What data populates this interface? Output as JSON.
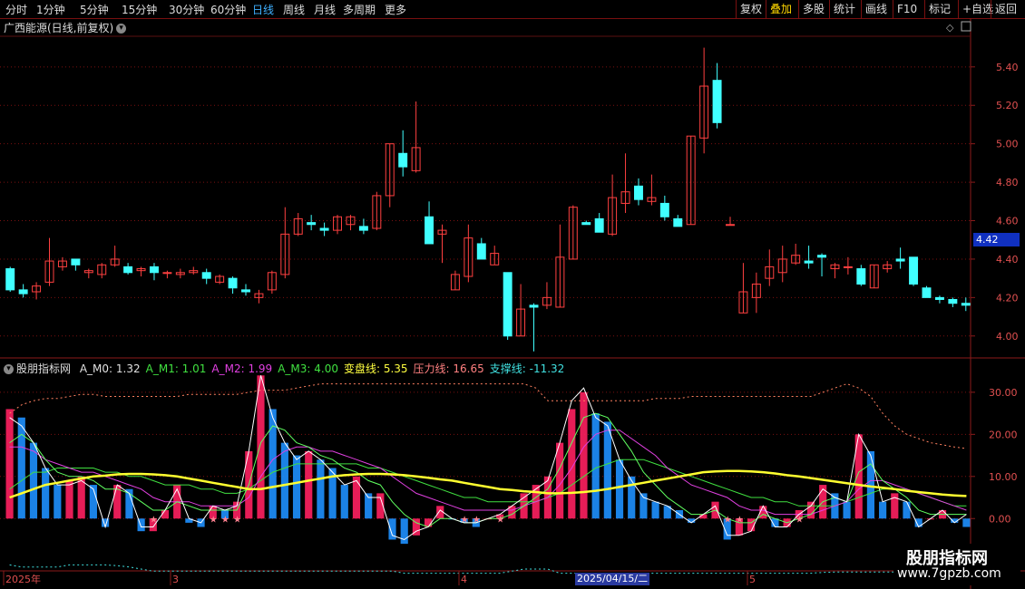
{
  "toolbar": {
    "periods": [
      "分时",
      "1分钟",
      "5分钟",
      "15分钟",
      "30分钟",
      "60分钟",
      "日线",
      "周线",
      "月线",
      "多周期",
      "更多"
    ],
    "active_period": "日线",
    "right_buttons": [
      "复权",
      "叠加",
      "多股",
      "统计",
      "画线",
      "F10",
      "标记",
      "+自选",
      "返回"
    ],
    "active_right": "叠加"
  },
  "stock": {
    "title": "广西能源(日线,前复权)",
    "current_price": "4.42"
  },
  "indicator": {
    "name": "股朋指标网",
    "values": [
      {
        "label": "A_M0: 1.32",
        "color": "#e0e0e0"
      },
      {
        "label": "A_M1: 1.01",
        "color": "#40e040"
      },
      {
        "label": "A_M2: 1.99",
        "color": "#e040e0"
      },
      {
        "label": "A_M3: 4.00",
        "color": "#40e040"
      },
      {
        "label": "变盘线: 5.35",
        "color": "#ffff40"
      },
      {
        "label": "压力线: 16.65",
        "color": "#ff8080"
      },
      {
        "label": "支撑线: -11.32",
        "color": "#40e0e0"
      }
    ]
  },
  "x_axis": {
    "labels": [
      "2025年",
      "3",
      "4",
      "2025/04/15/二",
      "5"
    ]
  },
  "watermark": {
    "line1": "股朋指标网",
    "line2": "www.7gpzb.com"
  },
  "chart_data": [
    {
      "type": "candlestick",
      "title": "广西能源(日线,前复权)",
      "ylim": [
        3.9,
        5.55
      ],
      "y_ticks": [
        "5.40",
        "5.20",
        "5.00",
        "4.80",
        "4.60",
        "4.40",
        "4.20",
        "4.00"
      ],
      "candles": [
        [
          4.35,
          4.24,
          4.36,
          4.23
        ],
        [
          4.24,
          4.22,
          4.27,
          4.2
        ],
        [
          4.23,
          4.26,
          4.28,
          4.19
        ],
        [
          4.28,
          4.39,
          4.51,
          4.26
        ],
        [
          4.36,
          4.39,
          4.41,
          4.34
        ],
        [
          4.4,
          4.37,
          4.4,
          4.34
        ],
        [
          4.33,
          4.34,
          4.35,
          4.3
        ],
        [
          4.32,
          4.37,
          4.38,
          4.3
        ],
        [
          4.37,
          4.4,
          4.47,
          4.36
        ],
        [
          4.36,
          4.33,
          4.38,
          4.32
        ],
        [
          4.34,
          4.35,
          4.36,
          4.31
        ],
        [
          4.36,
          4.33,
          4.38,
          4.29
        ],
        [
          4.33,
          4.33,
          4.34,
          4.3
        ],
        [
          4.32,
          4.33,
          4.35,
          4.3
        ],
        [
          4.33,
          4.34,
          4.36,
          4.32
        ],
        [
          4.33,
          4.3,
          4.35,
          4.27
        ],
        [
          4.28,
          4.31,
          4.32,
          4.27
        ],
        [
          4.3,
          4.25,
          4.31,
          4.22
        ],
        [
          4.24,
          4.23,
          4.27,
          4.21
        ],
        [
          4.2,
          4.22,
          4.24,
          4.17
        ],
        [
          4.24,
          4.33,
          4.34,
          4.22
        ],
        [
          4.32,
          4.53,
          4.67,
          4.3
        ],
        [
          4.53,
          4.61,
          4.64,
          4.52
        ],
        [
          4.59,
          4.58,
          4.63,
          4.55
        ],
        [
          4.56,
          4.55,
          4.59,
          4.52
        ],
        [
          4.55,
          4.62,
          4.63,
          4.53
        ],
        [
          4.58,
          4.62,
          4.63,
          4.55
        ],
        [
          4.57,
          4.55,
          4.61,
          4.53
        ],
        [
          4.56,
          4.73,
          4.75,
          4.55
        ],
        [
          4.73,
          5.0,
          5.0,
          4.67
        ],
        [
          4.95,
          4.88,
          5.07,
          4.83
        ],
        [
          4.86,
          4.98,
          5.22,
          4.85
        ],
        [
          4.62,
          4.48,
          4.7,
          4.48
        ],
        [
          4.53,
          4.55,
          4.58,
          4.38
        ],
        [
          4.24,
          4.32,
          4.34,
          4.24
        ],
        [
          4.31,
          4.51,
          4.58,
          4.28
        ],
        [
          4.48,
          4.4,
          4.51,
          4.4
        ],
        [
          4.37,
          4.43,
          4.47,
          4.37
        ],
        [
          4.33,
          4.0,
          4.33,
          3.98
        ],
        [
          4.0,
          4.14,
          4.27,
          4.0
        ],
        [
          4.16,
          4.15,
          4.17,
          3.92
        ],
        [
          4.16,
          4.2,
          4.28,
          4.14
        ],
        [
          4.15,
          4.41,
          4.58,
          4.15
        ],
        [
          4.4,
          4.67,
          4.68,
          4.4
        ],
        [
          4.59,
          4.58,
          4.6,
          4.58
        ],
        [
          4.61,
          4.54,
          4.64,
          4.54
        ],
        [
          4.53,
          4.72,
          4.84,
          4.52
        ],
        [
          4.69,
          4.75,
          4.95,
          4.64
        ],
        [
          4.78,
          4.71,
          4.82,
          4.68
        ],
        [
          4.7,
          4.72,
          4.84,
          4.68
        ],
        [
          4.69,
          4.62,
          4.73,
          4.6
        ],
        [
          4.61,
          4.57,
          4.63,
          4.57
        ],
        [
          4.58,
          5.04,
          5.04,
          4.58
        ],
        [
          5.03,
          5.3,
          5.5,
          4.95
        ],
        [
          5.33,
          5.11,
          5.42,
          5.08
        ],
        [
          4.58,
          4.58,
          4.62,
          4.58
        ],
        [
          4.12,
          4.23,
          4.38,
          4.12
        ],
        [
          4.2,
          4.27,
          4.33,
          4.12
        ],
        [
          4.3,
          4.36,
          4.45,
          4.26
        ],
        [
          4.33,
          4.4,
          4.47,
          4.28
        ],
        [
          4.38,
          4.42,
          4.48,
          4.37
        ],
        [
          4.39,
          4.38,
          4.47,
          4.35
        ],
        [
          4.42,
          4.41,
          4.43,
          4.31
        ],
        [
          4.35,
          4.37,
          4.38,
          4.3
        ],
        [
          4.36,
          4.36,
          4.41,
          4.32
        ],
        [
          4.35,
          4.27,
          4.37,
          4.26
        ],
        [
          4.25,
          4.37,
          4.37,
          4.25
        ],
        [
          4.35,
          4.37,
          4.39,
          4.33
        ],
        [
          4.4,
          4.39,
          4.46,
          4.35
        ],
        [
          4.41,
          4.27,
          4.41,
          4.26
        ],
        [
          4.25,
          4.2,
          4.26,
          4.2
        ],
        [
          4.2,
          4.19,
          4.21,
          4.17
        ],
        [
          4.19,
          4.17,
          4.2,
          4.15
        ],
        [
          4.17,
          4.16,
          4.2,
          4.13
        ]
      ]
    },
    {
      "type": "bar+line",
      "title": "股朋指标网",
      "ylim": [
        -12,
        36
      ],
      "y_ticks": [
        "30.00",
        "20.00",
        "10.00",
        "0.00"
      ],
      "bars": [
        26,
        24,
        18,
        12,
        8,
        9,
        10,
        8,
        -2,
        8,
        7,
        -3,
        -3,
        2,
        8,
        -1,
        -2,
        3,
        2,
        4,
        16,
        34,
        26,
        18,
        15,
        16,
        14,
        12,
        8,
        10,
        6,
        6,
        -5,
        -6,
        -4,
        -2,
        3,
        0,
        -1,
        -2,
        0,
        1,
        3,
        6,
        8,
        10,
        18,
        26,
        30,
        25,
        23,
        14,
        10,
        6,
        4,
        3,
        2,
        -1,
        1,
        4,
        -5,
        -4,
        -3,
        3,
        -2,
        -2,
        2,
        4,
        8,
        6,
        4,
        20,
        16,
        4,
        6,
        4,
        -2,
        0,
        2,
        -1,
        -2
      ],
      "m0": [
        24,
        22,
        18,
        12,
        8,
        8,
        9,
        7,
        -2,
        8,
        6,
        -2,
        -2,
        2,
        7,
        0,
        -1,
        3,
        2,
        3,
        16,
        34,
        24,
        18,
        14,
        16,
        14,
        11,
        8,
        9,
        5,
        5,
        -4,
        -5,
        -3,
        -2,
        2,
        0,
        -1,
        -1,
        0,
        1,
        3,
        5,
        7,
        9,
        18,
        28,
        31,
        24,
        22,
        14,
        9,
        5,
        4,
        3,
        1,
        -1,
        1,
        3,
        -4,
        -4,
        -3,
        3,
        -2,
        -2,
        1,
        3,
        7,
        5,
        4,
        20,
        15,
        4,
        5,
        4,
        -2,
        0,
        2,
        -1,
        1
      ],
      "m1": [
        18,
        20,
        18,
        14,
        11,
        10,
        10,
        9,
        7,
        7,
        6,
        4,
        2,
        2,
        4,
        3,
        2,
        2,
        2,
        2,
        8,
        18,
        22,
        21,
        18,
        17,
        15,
        14,
        12,
        11,
        9,
        8,
        4,
        1,
        -1,
        -2,
        0,
        0,
        -1,
        -1,
        0,
        0,
        1,
        3,
        5,
        7,
        12,
        18,
        24,
        25,
        24,
        20,
        16,
        11,
        8,
        5,
        3,
        1,
        1,
        2,
        0,
        -1,
        -1,
        1,
        0,
        -1,
        0,
        1,
        4,
        5,
        4,
        11,
        13,
        9,
        7,
        5,
        2,
        1,
        1,
        1,
        1
      ],
      "m2": [
        17,
        17,
        16,
        14,
        13,
        12,
        11,
        11,
        10,
        9,
        8,
        7,
        5,
        4,
        4,
        4,
        3,
        3,
        3,
        3,
        5,
        10,
        14,
        16,
        17,
        17,
        16,
        16,
        15,
        14,
        13,
        12,
        10,
        8,
        6,
        5,
        4,
        3,
        2,
        2,
        2,
        2,
        2,
        3,
        4,
        5,
        8,
        12,
        17,
        20,
        21,
        21,
        19,
        17,
        15,
        12,
        10,
        8,
        7,
        6,
        5,
        3,
        2,
        2,
        1,
        1,
        1,
        1,
        2,
        3,
        4,
        7,
        9,
        9,
        8,
        7,
        6,
        5,
        4,
        3,
        2
      ],
      "m3": [
        7,
        9,
        11,
        11,
        12,
        12,
        12,
        12,
        11,
        11,
        10,
        10,
        9,
        8,
        8,
        8,
        7,
        7,
        6,
        6,
        7,
        9,
        11,
        12,
        13,
        13,
        13,
        13,
        13,
        13,
        12,
        12,
        11,
        10,
        9,
        8,
        7,
        6,
        5,
        5,
        4,
        4,
        4,
        4,
        4,
        5,
        6,
        8,
        10,
        12,
        13,
        14,
        14,
        14,
        13,
        12,
        11,
        10,
        9,
        8,
        7,
        6,
        5,
        5,
        4,
        4,
        3,
        3,
        3,
        3,
        4,
        5,
        6,
        7,
        7,
        7,
        6,
        5,
        4,
        3,
        3
      ],
      "turn_line": [
        5,
        6,
        7,
        8,
        8.5,
        9,
        9.5,
        10,
        10.2,
        10.5,
        10.6,
        10.6,
        10.5,
        10.3,
        10,
        9.5,
        9,
        8.5,
        8,
        7.5,
        7,
        7,
        7.5,
        8,
        8.5,
        9,
        9.5,
        10,
        10.3,
        10.5,
        10.6,
        10.6,
        10.5,
        10.3,
        10,
        9.7,
        9.3,
        9,
        8.5,
        8,
        7.5,
        7,
        6.8,
        6.5,
        6.3,
        6,
        6,
        6.1,
        6.3,
        6.6,
        7,
        7.5,
        8,
        8.5,
        9,
        9.5,
        10,
        10.5,
        11,
        11.2,
        11.3,
        11.3,
        11.2,
        11,
        10.7,
        10.3,
        10,
        9.6,
        9.2,
        8.8,
        8.4,
        8,
        7.6,
        7.3,
        7,
        6.6,
        6.3,
        6,
        5.7,
        5.5,
        5.35
      ],
      "pressure_line": [
        25,
        27,
        28,
        28.5,
        28.5,
        29,
        29.5,
        29.5,
        29,
        29,
        29,
        29,
        29,
        29,
        29,
        29.5,
        29.5,
        29.5,
        29.5,
        29.5,
        30,
        30.5,
        30.5,
        30.5,
        31,
        31.5,
        32,
        32,
        32,
        32,
        32,
        32,
        32,
        32,
        32,
        32,
        32,
        32,
        32,
        32,
        32,
        32,
        32,
        32,
        31,
        28,
        28,
        28,
        28,
        28,
        28,
        28,
        28,
        28,
        28.5,
        28.5,
        28.5,
        29,
        29,
        29,
        29,
        29,
        29,
        29,
        29,
        29,
        29,
        29,
        30,
        31,
        32,
        31,
        29,
        25,
        22,
        20,
        19,
        18,
        17.5,
        17,
        16.65
      ],
      "support_line": [
        -11,
        -11.5,
        -11.5,
        -11.5,
        -11.5,
        -11,
        -11,
        -11,
        -11,
        -11.2,
        -11.5,
        -12,
        -12.5,
        -12.5,
        -12.5,
        -12.5,
        -12.5,
        -12.5,
        -12.5,
        -12.5,
        -12.5,
        -12.5,
        -12.5,
        -12.5,
        -12.5,
        -12.5,
        -12.5,
        -12.5,
        -12.5,
        -12.5,
        -12.5,
        -12.5,
        -12.5,
        -13,
        -13,
        -13,
        -13,
        -13,
        -13,
        -13,
        -13,
        -13,
        -12.5,
        -12,
        -12,
        -12,
        -13,
        -13,
        -13,
        -13,
        -13,
        -13,
        -13,
        -13,
        -13,
        -13,
        -13,
        -13,
        -13,
        -13,
        -13,
        -13,
        -13,
        -13,
        -13,
        -13,
        -13,
        -13,
        -12.8,
        -12.7,
        -12.7,
        -12.7,
        -12.7,
        -12.7,
        -12.7,
        -12.7,
        -12.6,
        -12.6,
        -12.5,
        -12,
        -11.32
      ]
    }
  ]
}
